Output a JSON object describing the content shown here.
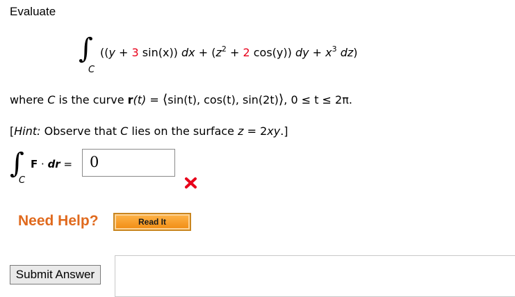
{
  "question": {
    "prompt": "Evaluate",
    "integral_sub": "C",
    "integrand": {
      "open": "((",
      "y": "y",
      "plus1": " + ",
      "coef1": "3",
      "sinx": " sin(x)) ",
      "dx": "dx",
      "plus2": " + (",
      "z": "z",
      "zexp": "2",
      "plus3": " + ",
      "coef2": "2",
      "cosy": " cos(y)) ",
      "dy": "dy",
      "plus4": " + ",
      "x": "x",
      "xexp": "3",
      "space": " ",
      "dz": "dz",
      "close": ")"
    },
    "curve_line": {
      "pre": "where ",
      "C": "C",
      "mid": " is the curve ",
      "r": "r",
      "t_paren": "(t)",
      "eq": " = ",
      "vec_open": "⟨",
      "vec_body": "sin(t), cos(t), sin(2t)",
      "vec_close": "⟩",
      "range": ", 0 ≤ t ≤ 2π."
    },
    "hint": {
      "open": "[",
      "label": "Hint:",
      "text1": " Observe that ",
      "C": "C",
      "text2": " lies on the surface ",
      "z": "z",
      "text3": " = 2",
      "xy": "xy",
      "close": ".]"
    }
  },
  "answer": {
    "integral_sub": "C",
    "F": "F",
    "dot": " · ",
    "dr": "dr",
    "equals": " = ",
    "value": "0",
    "status_icon": "x-mark-icon",
    "status_color": "#e8001a"
  },
  "help": {
    "label": "Need Help?",
    "read_button": "Read It"
  },
  "submit": {
    "label": "Submit Answer"
  }
}
